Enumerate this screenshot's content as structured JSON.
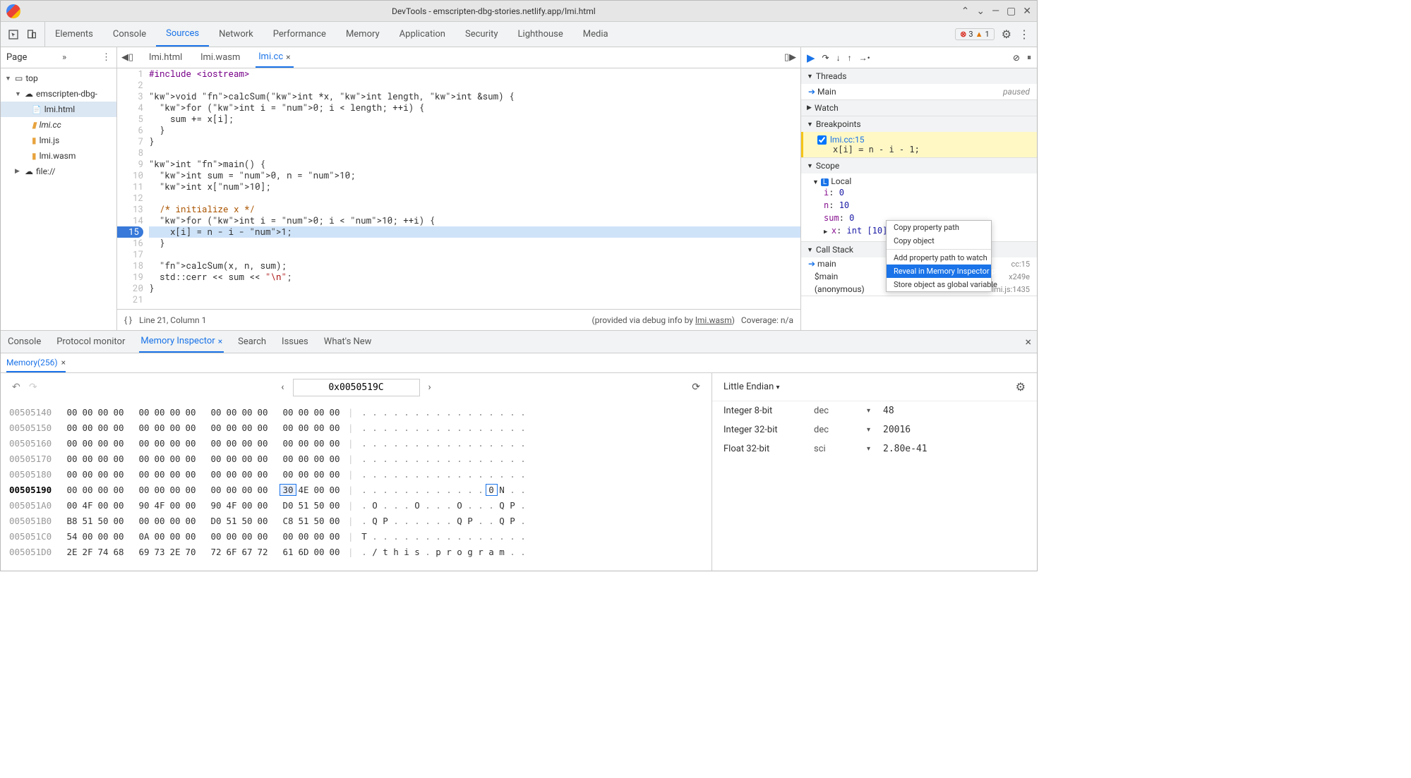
{
  "title": "DevTools - emscripten-dbg-stories.netlify.app/lmi.html",
  "mainTabs": [
    "Elements",
    "Console",
    "Sources",
    "Network",
    "Performance",
    "Memory",
    "Application",
    "Security",
    "Lighthouse",
    "Media"
  ],
  "activeMainTab": "Sources",
  "errors": "3",
  "warnings": "1",
  "navHeader": "Page",
  "tree": {
    "top": "top",
    "domain": "emscripten-dbg-",
    "files": [
      "lmi.html",
      "lmi.cc",
      "lmi.js",
      "lmi.wasm"
    ],
    "file2": "file://"
  },
  "editorTabs": [
    "lmi.html",
    "lmi.wasm",
    "lmi.cc"
  ],
  "activeEditorTab": "lmi.cc",
  "code": [
    "#include <iostream>",
    "",
    "void calcSum(int *x, int length, int &sum) {",
    "  for (int i = 0; i < length; ++i) {",
    "    sum += x[i];",
    "  }",
    "}",
    "",
    "int main() {",
    "  int sum = 0, n = 10;",
    "  int x[10];",
    "",
    "  /* initialize x */",
    "  for (int i = 0; i < 10; ++i) {",
    "    x[i] = n - i - 1;",
    "  }",
    "",
    "  calcSum(x, n, sum);",
    "  std::cerr << sum << \"\\n\";",
    "}",
    ""
  ],
  "breakpointLine": 15,
  "statusLeft": "Line 21, Column 1",
  "statusRight_prefix": "(provided via debug info by ",
  "statusRight_link": "lmi.wasm",
  "statusRight_suffix": ")",
  "coverage": "Coverage: n/a",
  "threadsHdr": "Threads",
  "thread": {
    "name": "Main",
    "status": "paused"
  },
  "watchHdr": "Watch",
  "breakpointsHdr": "Breakpoints",
  "breakpoint": {
    "loc": "lmi.cc:15",
    "snip": "x[i] = n - i - 1;"
  },
  "scopeHdr": "Scope",
  "scope": {
    "local": "Local",
    "vars": [
      {
        "k": "i",
        "v": "0"
      },
      {
        "k": "n",
        "v": "10"
      },
      {
        "k": "sum",
        "v": "0"
      },
      {
        "k": "x",
        "v": "int [10]",
        "arrow": true
      }
    ]
  },
  "callstackHdr": "Call Stack",
  "callstack": [
    {
      "name": "main",
      "loc": "cc:15",
      "arrow": true
    },
    {
      "name": "$main",
      "loc": "x249e"
    },
    {
      "name": "(anonymous)",
      "loc": "lmi.js:1435"
    }
  ],
  "ctxmenu": [
    "Copy property path",
    "Copy object",
    "Add property path to watch",
    "Reveal in Memory Inspector panel",
    "Store object as global variable"
  ],
  "ctxmenuSel": 3,
  "drawerTabs": [
    "Console",
    "Protocol monitor",
    "Memory Inspector",
    "Search",
    "Issues",
    "What's New"
  ],
  "activeDrawerTab": "Memory Inspector",
  "memTab": "Memory(256)",
  "memAddr": "0x0050519C",
  "endian": "Little Endian",
  "hex": [
    {
      "a": "00505140",
      "b": [
        "00",
        "00",
        "00",
        "00",
        "00",
        "00",
        "00",
        "00",
        "00",
        "00",
        "00",
        "00",
        "00",
        "00",
        "00",
        "00"
      ],
      "c": "................"
    },
    {
      "a": "00505150",
      "b": [
        "00",
        "00",
        "00",
        "00",
        "00",
        "00",
        "00",
        "00",
        "00",
        "00",
        "00",
        "00",
        "00",
        "00",
        "00",
        "00"
      ],
      "c": "................"
    },
    {
      "a": "00505160",
      "b": [
        "00",
        "00",
        "00",
        "00",
        "00",
        "00",
        "00",
        "00",
        "00",
        "00",
        "00",
        "00",
        "00",
        "00",
        "00",
        "00"
      ],
      "c": "................"
    },
    {
      "a": "00505170",
      "b": [
        "00",
        "00",
        "00",
        "00",
        "00",
        "00",
        "00",
        "00",
        "00",
        "00",
        "00",
        "00",
        "00",
        "00",
        "00",
        "00"
      ],
      "c": "................"
    },
    {
      "a": "00505180",
      "b": [
        "00",
        "00",
        "00",
        "00",
        "00",
        "00",
        "00",
        "00",
        "00",
        "00",
        "00",
        "00",
        "00",
        "00",
        "00",
        "00"
      ],
      "c": "................"
    },
    {
      "a": "00505190",
      "b": [
        "00",
        "00",
        "00",
        "00",
        "00",
        "00",
        "00",
        "00",
        "00",
        "00",
        "00",
        "00",
        "30",
        "4E",
        "00",
        "00"
      ],
      "c": "............0N..",
      "sel": 12,
      "asel": 12,
      "bold": true
    },
    {
      "a": "005051A0",
      "b": [
        "00",
        "4F",
        "00",
        "00",
        "90",
        "4F",
        "00",
        "00",
        "90",
        "4F",
        "00",
        "00",
        "D0",
        "51",
        "50",
        "00"
      ],
      "c": ".O...O...O...QP."
    },
    {
      "a": "005051B0",
      "b": [
        "B8",
        "51",
        "50",
        "00",
        "00",
        "00",
        "00",
        "00",
        "D0",
        "51",
        "50",
        "00",
        "C8",
        "51",
        "50",
        "00"
      ],
      "c": ".QP......QP..QP."
    },
    {
      "a": "005051C0",
      "b": [
        "54",
        "00",
        "00",
        "00",
        "0A",
        "00",
        "00",
        "00",
        "00",
        "00",
        "00",
        "00",
        "00",
        "00",
        "00",
        "00"
      ],
      "c": "T..............."
    },
    {
      "a": "005051D0",
      "b": [
        "2E",
        "2F",
        "74",
        "68",
        "69",
        "73",
        "2E",
        "70",
        "72",
        "6F",
        "67",
        "72",
        "61",
        "6D",
        "00",
        "00"
      ],
      "c": "./this.program.."
    }
  ],
  "valTypes": [
    {
      "lbl": "Integer 8-bit",
      "fmt": "dec",
      "val": "48"
    },
    {
      "lbl": "Integer 32-bit",
      "fmt": "dec",
      "val": "20016"
    },
    {
      "lbl": "Float 32-bit",
      "fmt": "sci",
      "val": "2.80e-41"
    }
  ]
}
